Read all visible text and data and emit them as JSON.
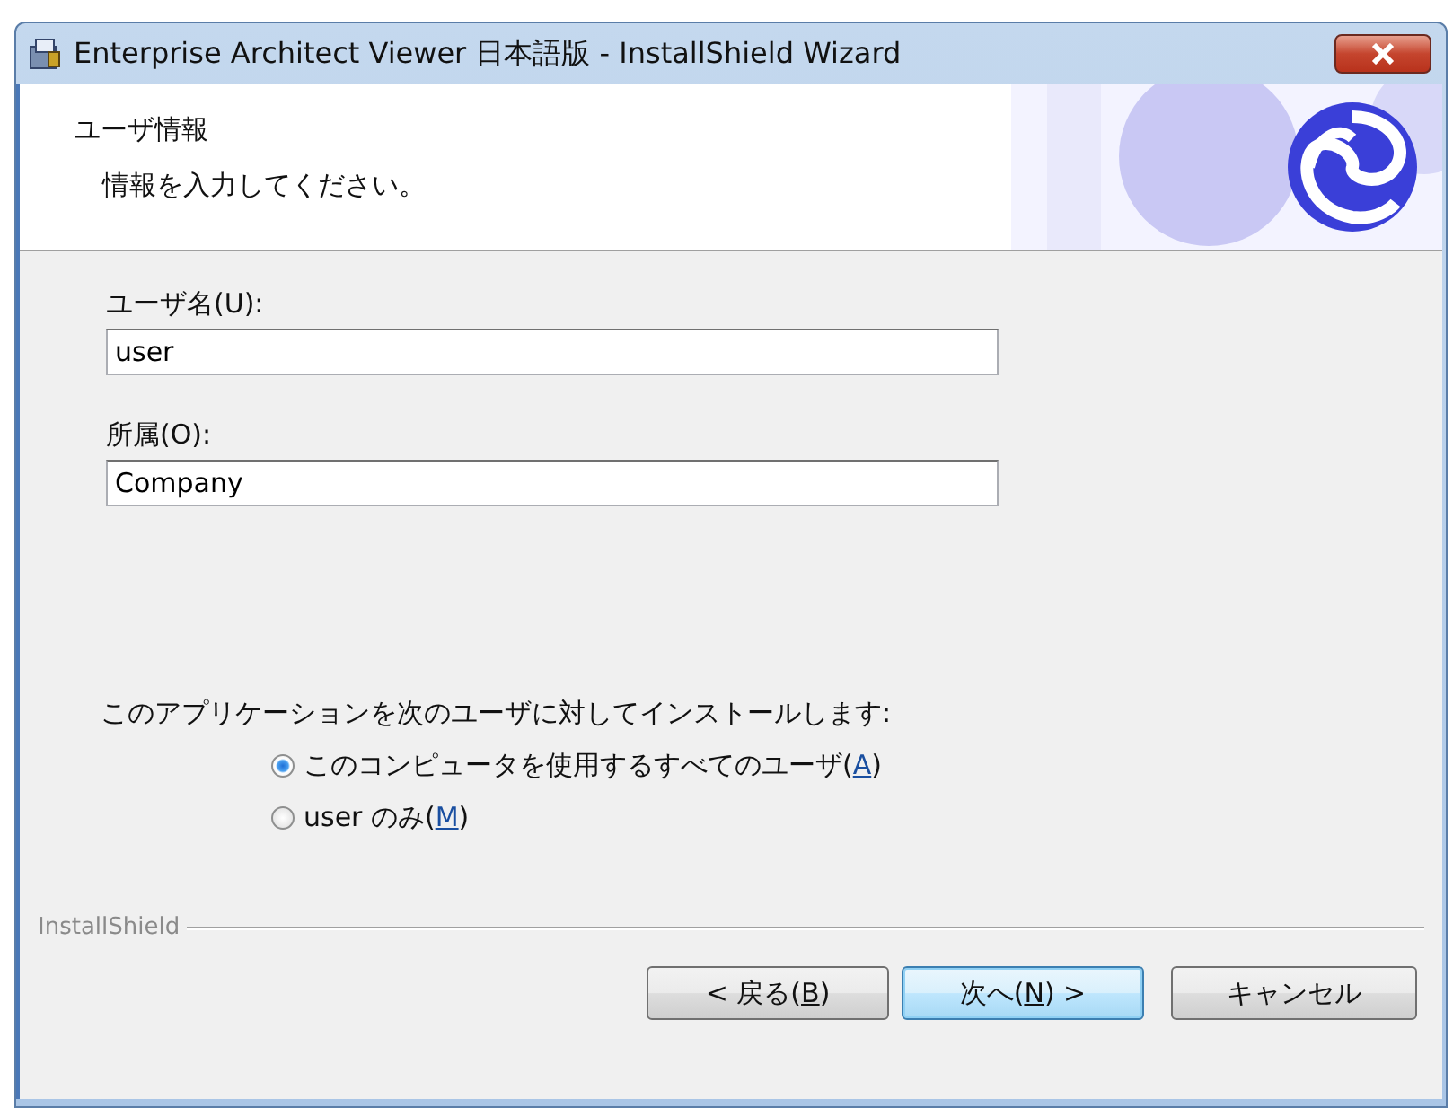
{
  "window": {
    "title": "Enterprise Architect Viewer 日本語版 - InstallShield Wizard"
  },
  "header": {
    "title": "ユーザ情報",
    "subtitle": "情報を入力してください。"
  },
  "fields": [
    {
      "label": "ユーザ名(U):",
      "value": "user"
    },
    {
      "label": "所属(O):",
      "value": "Company"
    }
  ],
  "install_for": {
    "prompt": "このアプリケーションを次のユーザに対してインストールします:",
    "options": [
      {
        "text_before": "このコンピュータを使用するすべてのユーザ(",
        "access_key": "A",
        "text_after": ")",
        "selected": true
      },
      {
        "text_before": "user のみ(",
        "access_key": "M",
        "text_after": ")",
        "selected": false
      }
    ]
  },
  "footer": {
    "brand": "InstallShield"
  },
  "buttons": [
    {
      "text_before": "< 戻る(",
      "access_key": "B",
      "text_after": ")",
      "default": false
    },
    {
      "text_before": "次へ(",
      "access_key": "N",
      "text_after": ") >",
      "default": true
    },
    {
      "text_before": "キャンセル",
      "default": false
    }
  ]
}
